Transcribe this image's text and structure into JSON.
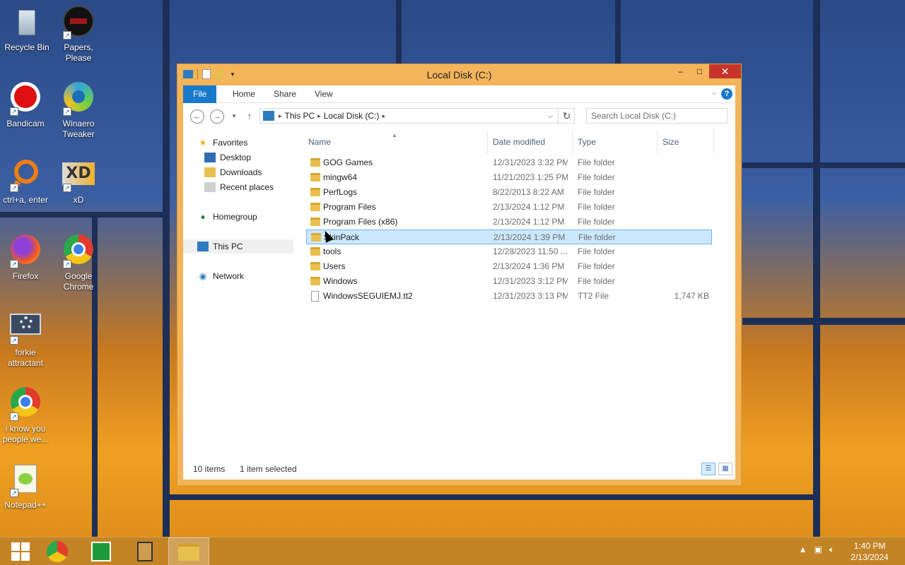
{
  "desktop": {
    "icons": [
      {
        "label": "Recycle Bin"
      },
      {
        "label": "Papers, Please"
      },
      {
        "label": "Bandicam"
      },
      {
        "label": "Winaero Tweaker"
      },
      {
        "label": "ctrl+a, enter"
      },
      {
        "label": "xD"
      },
      {
        "label": "Firefox"
      },
      {
        "label": "Google Chrome"
      },
      {
        "label": "forkie attractant"
      },
      {
        "label": "i know you people we..."
      },
      {
        "label": "Notepad++"
      }
    ]
  },
  "window": {
    "title": "Local Disk (C:)",
    "controls": {
      "minimize": "–",
      "maximize": "□",
      "close": "✕"
    },
    "ribbon": {
      "tabs": [
        "File",
        "Home",
        "Share",
        "View"
      ],
      "help": "?"
    },
    "address": {
      "crumbs": [
        "This PC",
        "Local Disk (C:)"
      ]
    },
    "search": {
      "placeholder": "Search Local Disk (C:)"
    },
    "nav": {
      "favorites": "Favorites",
      "desktop": "Desktop",
      "downloads": "Downloads",
      "recent": "Recent places",
      "homegroup": "Homegroup",
      "thispc": "This PC",
      "network": "Network"
    },
    "columns": {
      "name": "Name",
      "date": "Date modified",
      "type": "Type",
      "size": "Size"
    },
    "files": [
      {
        "name": "GOG Games",
        "date": "12/31/2023 3:32 PM",
        "type": "File folder",
        "size": ""
      },
      {
        "name": "mingw64",
        "date": "11/21/2023 1:25 PM",
        "type": "File folder",
        "size": ""
      },
      {
        "name": "PerfLogs",
        "date": "8/22/2013 8:22 AM",
        "type": "File folder",
        "size": ""
      },
      {
        "name": "Program Files",
        "date": "2/13/2024 1:12 PM",
        "type": "File folder",
        "size": ""
      },
      {
        "name": "Program Files (x86)",
        "date": "2/13/2024 1:12 PM",
        "type": "File folder",
        "size": ""
      },
      {
        "name": "SkinPack",
        "date": "2/13/2024 1:39 PM",
        "type": "File folder",
        "size": ""
      },
      {
        "name": "tools",
        "date": "12/28/2023 11:50 ...",
        "type": "File folder",
        "size": ""
      },
      {
        "name": "Users",
        "date": "2/13/2024 1:36 PM",
        "type": "File folder",
        "size": ""
      },
      {
        "name": "Windows",
        "date": "12/31/2023 3:12 PM",
        "type": "File folder",
        "size": ""
      },
      {
        "name": "WindowsSEGUIEMJ.tt2",
        "date": "12/31/2023 3:13 PM",
        "type": "TT2 File",
        "size": "1,747 KB"
      }
    ],
    "status": {
      "count": "10 items",
      "selected": "1 item selected"
    }
  },
  "taskbar": {
    "time": "1:40 PM",
    "date": "2/13/2024"
  },
  "colors": {
    "accent": "#1979ca",
    "frame": "#f3b45a",
    "close": "#c7352a",
    "selection": "#cce8ff"
  }
}
